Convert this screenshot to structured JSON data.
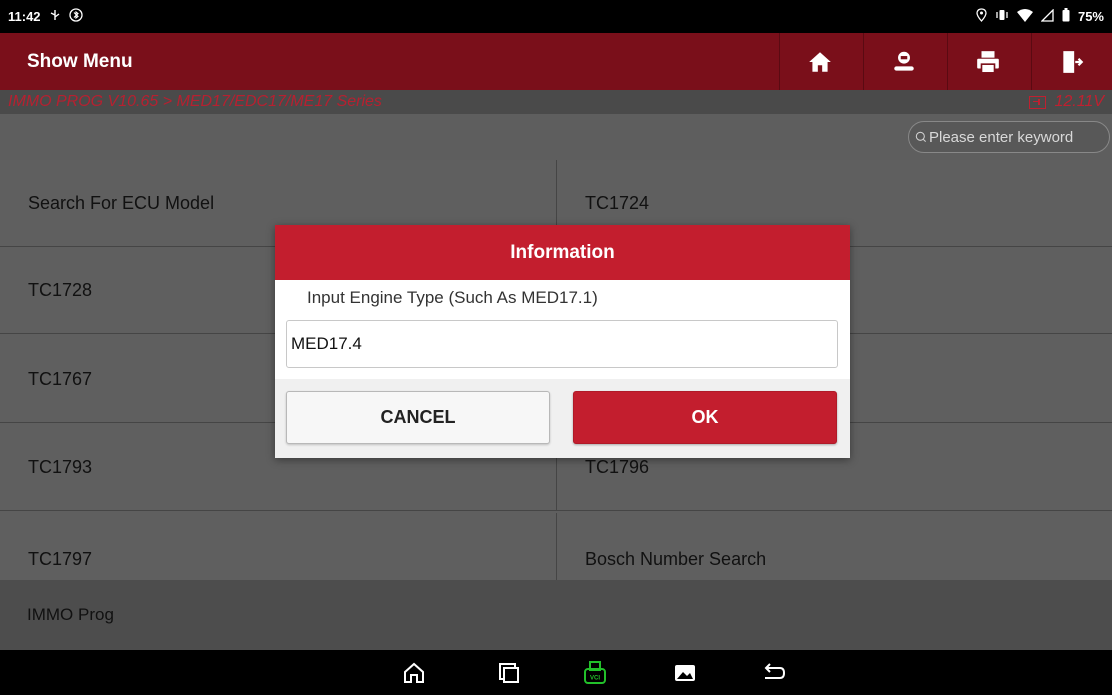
{
  "status_bar": {
    "time": "11:42",
    "left_icons": [
      "usb-icon",
      "bluetooth-icon"
    ],
    "right_icons": [
      "location-icon",
      "vibrate-icon",
      "wifi-icon",
      "signal-icon",
      "battery-icon"
    ],
    "battery": "75%"
  },
  "header": {
    "title": "Show Menu",
    "buttons": [
      "home-icon",
      "user-icon",
      "print-icon",
      "exit-icon"
    ]
  },
  "breadcrumb": {
    "path": "IMMO PROG V10.65 > MED17/EDC17/ME17 Series",
    "voltage": "12.11V"
  },
  "search": {
    "placeholder": "Please enter keyword"
  },
  "menu_items": [
    "Search For ECU Model",
    "TC1724",
    "TC1728",
    "TC1767",
    "TC1793",
    "TC1796",
    "TC1797",
    "Bosch Number Search"
  ],
  "footer_label": "IMMO Prog",
  "dialog": {
    "title": "Information",
    "prompt": "Input Engine Type (Such As MED17.1)",
    "input_value": "MED17.4",
    "cancel_label": "CANCEL",
    "ok_label": "OK"
  },
  "nav_bar": {
    "buttons": [
      "nav-home-icon",
      "nav-recents-icon",
      "vci-icon",
      "gallery-icon",
      "nav-back-icon"
    ]
  },
  "colors": {
    "header_bg": "#7a0f1a",
    "accent_red": "#c31e2e",
    "vci_green": "#22c02a"
  }
}
